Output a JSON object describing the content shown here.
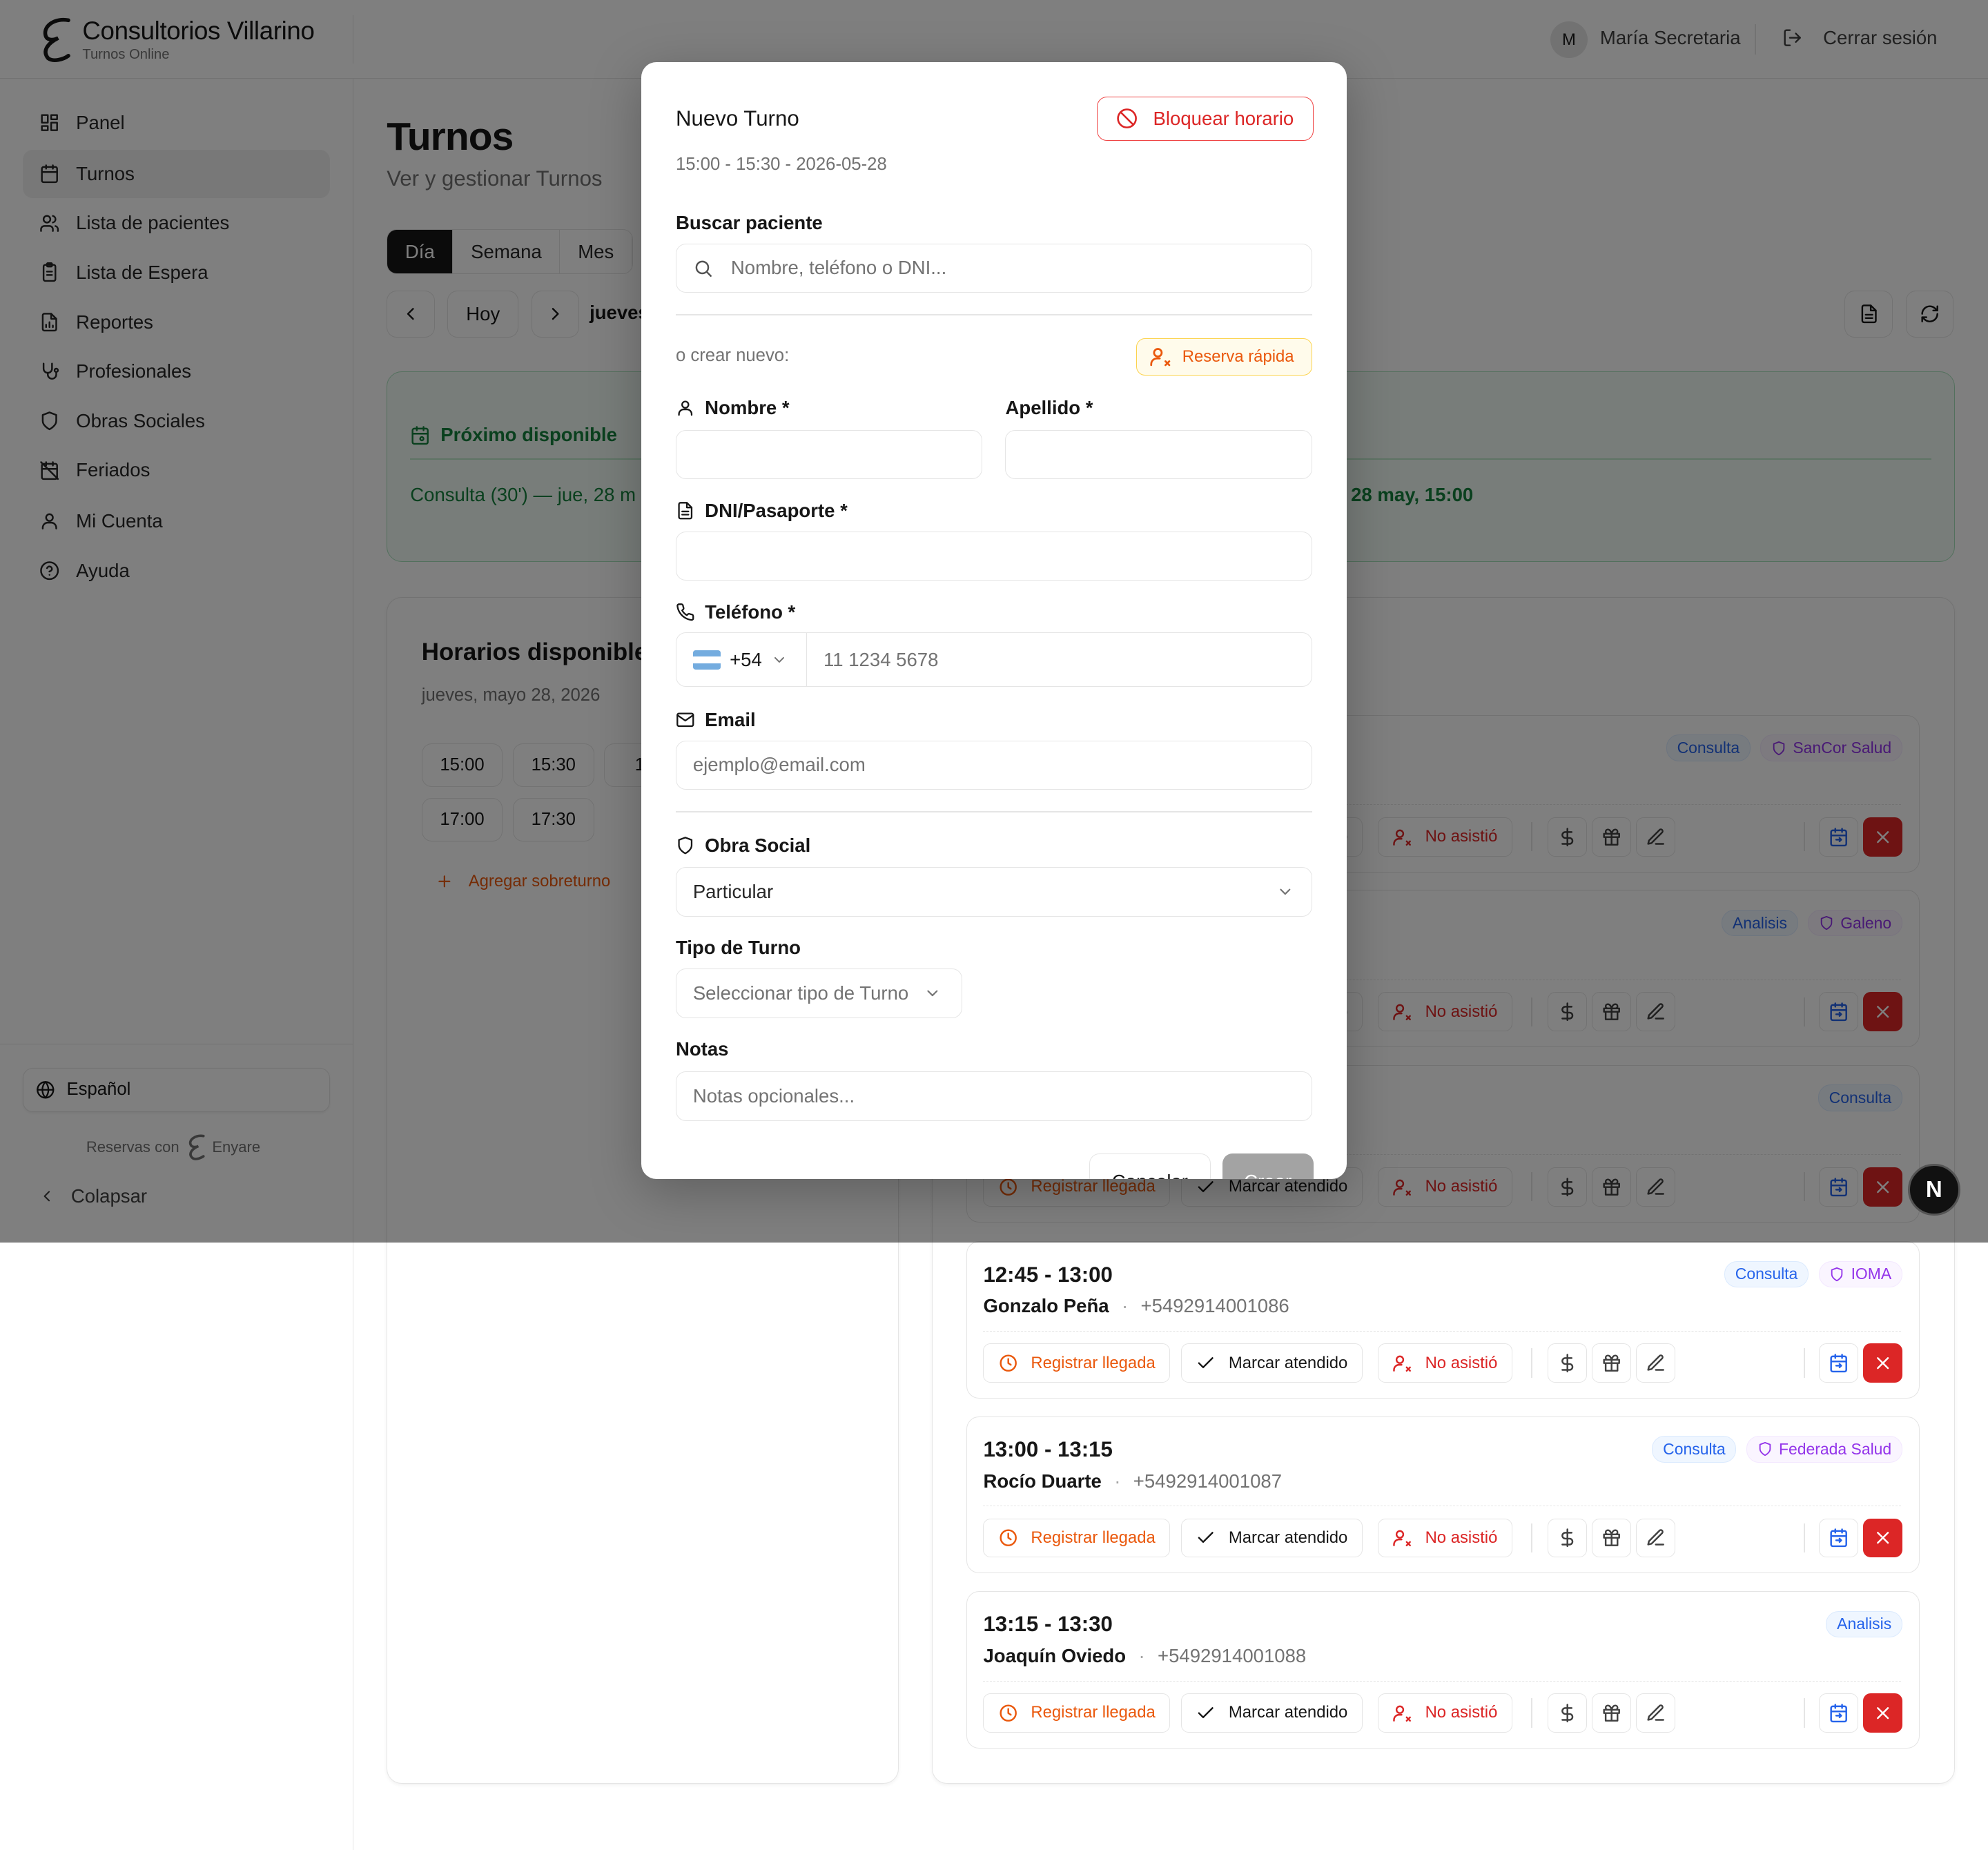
{
  "header": {
    "app_name": "Consultorios Villarino",
    "app_subtitle": "Turnos Online",
    "avatar_initial": "M",
    "user_name": "María Secretaria",
    "logout_label": "Cerrar sesión"
  },
  "sidebar": {
    "items": [
      {
        "label": "Panel",
        "icon": "dashboard-icon"
      },
      {
        "label": "Turnos",
        "icon": "calendar-icon"
      },
      {
        "label": "Lista de pacientes",
        "icon": "users-icon"
      },
      {
        "label": "Lista de Espera",
        "icon": "clipboard-icon"
      },
      {
        "label": "Reportes",
        "icon": "report-icon"
      },
      {
        "label": "Profesionales",
        "icon": "stethoscope-icon"
      },
      {
        "label": "Obras Sociales",
        "icon": "shield-icon"
      },
      {
        "label": "Feriados",
        "icon": "calendar-off-icon"
      },
      {
        "label": "Mi Cuenta",
        "icon": "user-icon"
      },
      {
        "label": "Ayuda",
        "icon": "help-icon"
      }
    ],
    "language": "Español",
    "powered_prefix": "Reservas con",
    "powered_brand": "Enyare",
    "collapse_label": "Colapsar"
  },
  "main": {
    "title": "Turnos",
    "subtitle": "Ver y gestionar Turnos",
    "view_tabs": [
      "Día",
      "Semana",
      "Mes"
    ],
    "today_label": "Hoy",
    "date_label": "jueves",
    "next_available": {
      "title": "Próximo disponible",
      "text": "Consulta (30') — jue, 28 m",
      "text_right": "28 may, 15:00"
    },
    "slots": {
      "title": "Horarios disponibles",
      "date": "jueves, mayo 28, 2026",
      "times": [
        "15:00",
        "15:30",
        "16",
        "17:00",
        "17:30"
      ],
      "overbook_label": "Agregar sobreturno"
    },
    "appointments": [
      {
        "time": "",
        "patient": "",
        "phone": "",
        "type": "Consulta",
        "insurance": "SanCor Salud"
      },
      {
        "time": "",
        "patient": "",
        "phone": "",
        "type": "Analisis",
        "insurance": "Galeno"
      },
      {
        "time": "",
        "patient": "",
        "phone": "",
        "type": "Consulta",
        "insurance": ""
      },
      {
        "time": "12:45 - 13:00",
        "patient": "Gonzalo Peña",
        "phone": "+5492914001086",
        "type": "Consulta",
        "insurance": "IOMA"
      },
      {
        "time": "13:00 - 13:15",
        "patient": "Rocío Duarte",
        "phone": "+5492914001087",
        "type": "Consulta",
        "insurance": "Federada Salud"
      },
      {
        "time": "13:15 - 13:30",
        "patient": "Joaquín Oviedo",
        "phone": "+5492914001088",
        "type": "Analisis",
        "insurance": ""
      }
    ],
    "actions": {
      "arrival": "Registrar llegada",
      "attended": "Marcar atendido",
      "no_show": "No asistió"
    }
  },
  "modal": {
    "title": "Nuevo Turno",
    "subtitle": "15:00 - 15:30 - 2026-05-28",
    "block_label": "Bloquear horario",
    "search_label": "Buscar paciente",
    "search_placeholder": "Nombre, teléfono o DNI...",
    "or_new": "o crear nuevo:",
    "quick_label": "Reserva rápida",
    "first_name_label": "Nombre *",
    "last_name_label": "Apellido *",
    "dni_label": "DNI/Pasaporte *",
    "phone_label": "Teléfono *",
    "country_code": "+54",
    "phone_placeholder": "11 1234 5678",
    "email_label": "Email",
    "email_placeholder": "ejemplo@email.com",
    "insurance_label": "Obra Social",
    "insurance_value": "Particular",
    "type_label": "Tipo de Turno",
    "type_placeholder": "Seleccionar tipo de Turno",
    "notes_label": "Notas",
    "notes_placeholder": "Notas opcionales...",
    "cancel_label": "Cancelar",
    "create_label": "Crear"
  },
  "dev_badge": "N",
  "colors": {
    "primary": "#171717",
    "danger": "#dc2626",
    "warning": "#ea580c",
    "success": "#15803d",
    "info": "#2563eb",
    "accent": "#9333ea"
  }
}
